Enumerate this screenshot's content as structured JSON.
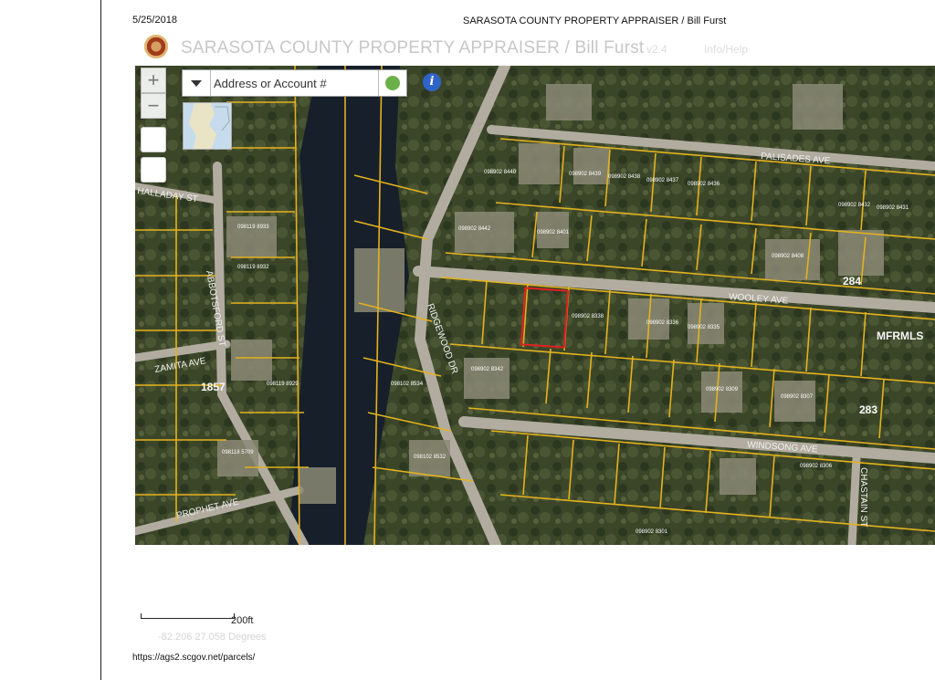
{
  "print_header": {
    "date": "5/25/2018",
    "title": "SARASOTA COUNTY PROPERTY APPRAISER / Bill Furst"
  },
  "app": {
    "title": "SARASOTA COUNTY PROPERTY APPRAISER / Bill Furst",
    "version": "v2.4",
    "info_help": "Info/Help"
  },
  "controls": {
    "zoom_in": "+",
    "zoom_out": "−",
    "search_placeholder": "Address or Account #",
    "info_label": "i"
  },
  "streets": {
    "palisades": "PALISADES AVE",
    "wooley": "WOOLEY AVE",
    "windsong": "WINDSONG AVE",
    "ridgewood": "RIDGEWOOD DR",
    "abbotsford": "ABBOTSFORD ST",
    "halladay": "HALLADAY ST",
    "zamita": "ZAMITA AVE",
    "prophet": "PROPHET AVE",
    "chastain": "CHASTAIN ST"
  },
  "block_numbers": {
    "b284": "284",
    "b283": "283",
    "b1857": "1857",
    "mfrmls": "MFRMLS"
  },
  "parcels": {
    "p1": "098902 8440",
    "p2": "098902 8439",
    "p3": "098902 8438",
    "p4": "098902 8437",
    "p5": "098902 8436",
    "p6": "098902 8442",
    "p7": "098902 8401",
    "p8": "098902 8432",
    "p9": "098902 8431",
    "p10": "098902 8338",
    "p11": "098902 8336",
    "p12": "098902 8335",
    "p13": "098902 8342",
    "p14": "098902 8309",
    "p15": "098902 8307",
    "p16": "098119 8932",
    "p17": "098119 8933",
    "p18": "098119 8929",
    "p19": "098102 8532",
    "p20": "098102 8534",
    "p21": "098118 5709",
    "p22": "098902 8301",
    "p23": "098902 8306",
    "p24": "098902 8408"
  },
  "footer": {
    "scale": "200ft",
    "coordinates": "-82.206 27.058 Degrees",
    "url": "https://ags2.scgov.net/parcels/"
  }
}
